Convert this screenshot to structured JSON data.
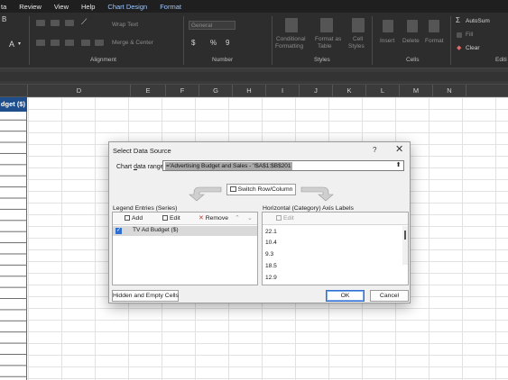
{
  "menu": {
    "items": [
      "ta",
      "Review",
      "View",
      "Help"
    ],
    "accent_items": [
      "Chart Design",
      "Format"
    ]
  },
  "ribbon": {
    "alignment": {
      "wrap_text": "Wrap Text",
      "merge_center": "Merge & Center",
      "label": "Alignment"
    },
    "number": {
      "format": "General",
      "symbols": [
        "$",
        "%",
        "9"
      ],
      "label": "Number"
    },
    "styles": {
      "conditional": [
        "Conditional",
        "Formatting"
      ],
      "format_as_table": [
        "Format as",
        "Table"
      ],
      "cell_styles": [
        "Cell",
        "Styles"
      ],
      "label": "Styles"
    },
    "cells": {
      "insert": "Insert",
      "delete": "Delete",
      "format": "Format",
      "label": "Cells"
    },
    "editing": {
      "autosum": "AutoSum",
      "fill": "Fill",
      "clear": "Clear",
      "label": "Editi"
    }
  },
  "columns": [
    "D",
    "E",
    "F",
    "G",
    "H",
    "I",
    "J",
    "K",
    "L",
    "M",
    "N"
  ],
  "sheet": {
    "budget_header": "dget ($)"
  },
  "dialog": {
    "title": "Select Data Source",
    "help": "?",
    "close": "✕",
    "range_label": "Chart data range:",
    "range_value": "='Advertising Budget and Sales - '!$A$1:$B$201",
    "switch_label": "Switch Row/Column",
    "legend_header": "Legend Entries (Series)",
    "axis_header": "Horizontal (Category) Axis Labels",
    "toolbar": {
      "add": "Add",
      "edit": "Edit",
      "remove": "Remove",
      "axis_edit": "Edit"
    },
    "series": [
      {
        "name": "TV Ad Budget ($)",
        "checked": true
      }
    ],
    "axis_labels": [
      "22.1",
      "10.4",
      "9.3",
      "18.5",
      "12.9"
    ],
    "hidden_empty": "Hidden and Empty Cells",
    "ok": "OK",
    "cancel": "Cancel"
  },
  "colors": {
    "accent": "#2f6fd1",
    "header_fill": "#1f4e8c",
    "ribbon": "#2d2d2d",
    "menubar": "#1f1f1f"
  }
}
